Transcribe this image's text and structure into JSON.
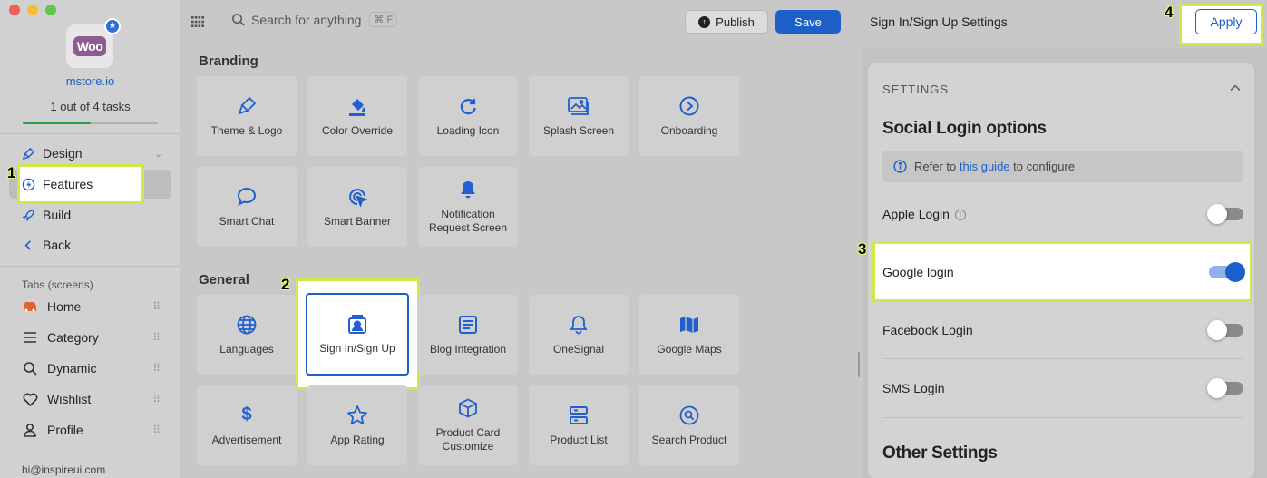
{
  "sidebar": {
    "app_name": "mstore.io",
    "tasks": "1 out of 4 tasks",
    "progress": 0.5,
    "nav": {
      "design": "Design",
      "features": "Features",
      "build": "Build",
      "back": "Back"
    },
    "tabs_label": "Tabs (screens)",
    "tabs": [
      "Home",
      "Category",
      "Dynamic",
      "Wishlist",
      "Profile"
    ],
    "email": "hi@inspireui.com",
    "logo_text": "Woo"
  },
  "topbar": {
    "search_placeholder": "Search for anything",
    "shortcut": "⌘ F",
    "publish": "Publish",
    "save": "Save",
    "panel_title": "Sign In/Sign Up Settings",
    "apply": "Apply"
  },
  "markers": [
    "1",
    "2",
    "3",
    "4"
  ],
  "main": {
    "branding_title": "Branding",
    "branding": [
      "Theme & Logo",
      "Color Override",
      "Loading Icon",
      "Splash Screen",
      "Onboarding",
      "Smart Chat",
      "Smart Banner",
      "Notification Request Screen"
    ],
    "general_title": "General",
    "general": [
      "Languages",
      "Sign In/Sign Up",
      "Blog Integration",
      "OneSignal",
      "Google Maps",
      "Advertisement",
      "App Rating",
      "Product Card Customize",
      "Product List",
      "Search Product"
    ]
  },
  "panel": {
    "settings_label": "SETTINGS",
    "social_title": "Social Login options",
    "info_prefix": "Refer to",
    "info_link": "this guide",
    "info_suffix": "to configure",
    "logins": [
      {
        "label": "Apple Login",
        "enabled": false
      },
      {
        "label": "Google login",
        "enabled": true
      },
      {
        "label": "Facebook Login",
        "enabled": false
      },
      {
        "label": "SMS Login",
        "enabled": false
      }
    ],
    "other_title": "Other Settings"
  },
  "colors": {
    "accent": "#1d5fc9",
    "highlight": "#cfe84a",
    "progress": "#2e9e4f",
    "woo": "#8c5d91"
  }
}
